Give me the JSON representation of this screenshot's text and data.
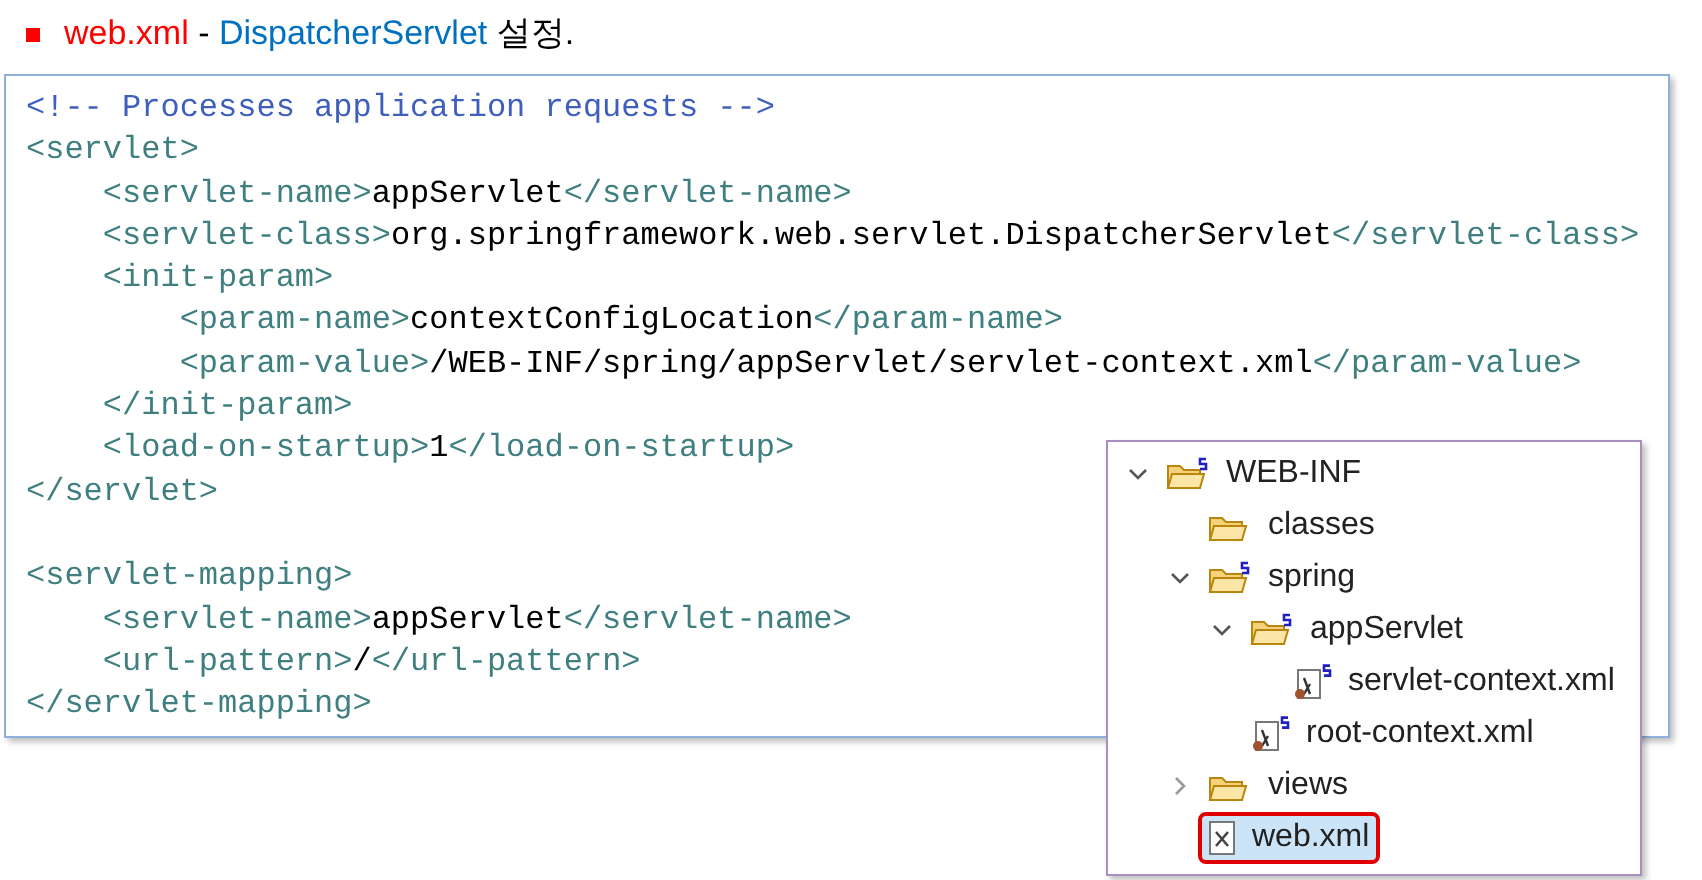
{
  "heading": {
    "parts": [
      {
        "kind": "file",
        "text": "web.xml"
      },
      {
        "kind": "plain",
        "text": " - "
      },
      {
        "kind": "class",
        "text": "DispatcherServlet"
      },
      {
        "kind": "plain",
        "text": " 설정."
      }
    ]
  },
  "code": {
    "lines": [
      {
        "tokens": [
          {
            "kind": "comment",
            "text": "<!-- Processes application requests -->"
          }
        ]
      },
      {
        "tokens": [
          {
            "kind": "tag",
            "text": "<servlet>"
          }
        ]
      },
      {
        "tokens": [
          {
            "kind": "tag",
            "text": "    <servlet-name>"
          },
          {
            "kind": "text",
            "text": "appServlet"
          },
          {
            "kind": "tag",
            "text": "</servlet-name>"
          }
        ]
      },
      {
        "tokens": [
          {
            "kind": "tag",
            "text": "    <servlet-class>"
          },
          {
            "kind": "text",
            "text": "org.springframework.web.servlet.DispatcherServlet"
          },
          {
            "kind": "tag",
            "text": "</servlet-class>"
          }
        ]
      },
      {
        "tokens": [
          {
            "kind": "tag",
            "text": "    <init-param>"
          }
        ]
      },
      {
        "tokens": [
          {
            "kind": "tag",
            "text": "        <param-name>"
          },
          {
            "kind": "text",
            "text": "contextConfigLocation"
          },
          {
            "kind": "tag",
            "text": "</param-name>"
          }
        ]
      },
      {
        "tokens": [
          {
            "kind": "tag",
            "text": "        <param-value>"
          },
          {
            "kind": "text",
            "text": "/WEB-INF/spring/appServlet/servlet-context.xml"
          },
          {
            "kind": "tag",
            "text": "</param-value>"
          }
        ]
      },
      {
        "tokens": [
          {
            "kind": "tag",
            "text": "    </init-param>"
          }
        ]
      },
      {
        "tokens": [
          {
            "kind": "tag",
            "text": "    <load-on-startup>"
          },
          {
            "kind": "text",
            "text": "1"
          },
          {
            "kind": "tag",
            "text": "</load-on-startup>"
          }
        ]
      },
      {
        "tokens": [
          {
            "kind": "tag",
            "text": "</servlet>"
          }
        ]
      },
      {
        "kind": "blank"
      },
      {
        "tokens": [
          {
            "kind": "tag",
            "text": "<servlet-mapping>"
          }
        ]
      },
      {
        "tokens": [
          {
            "kind": "tag",
            "text": "    <servlet-name>"
          },
          {
            "kind": "text",
            "text": "appServlet"
          },
          {
            "kind": "tag",
            "text": "</servlet-name>"
          }
        ]
      },
      {
        "tokens": [
          {
            "kind": "tag",
            "text": "    <url-pattern>"
          },
          {
            "kind": "text",
            "text": "/"
          },
          {
            "kind": "tag",
            "text": "</url-pattern>"
          }
        ]
      },
      {
        "tokens": [
          {
            "kind": "tag",
            "text": "</servlet-mapping>"
          }
        ]
      }
    ]
  },
  "tree": {
    "items": [
      {
        "label": "WEB-INF",
        "kind": "spring-folder",
        "expanded": true,
        "selected": false,
        "children": [
          {
            "label": "classes",
            "kind": "folder",
            "selected": false
          },
          {
            "label": "spring",
            "kind": "spring-folder",
            "expanded": true,
            "selected": false,
            "children": [
              {
                "label": "appServlet",
                "kind": "spring-folder",
                "expanded": true,
                "selected": false,
                "children": [
                  {
                    "label": "servlet-context.xml",
                    "kind": "spring-file",
                    "selected": false
                  }
                ]
              },
              {
                "label": "root-context.xml",
                "kind": "spring-file",
                "selected": false
              }
            ]
          },
          {
            "label": "views",
            "kind": "folder",
            "expanded": false,
            "selected": false
          },
          {
            "label": "web.xml",
            "kind": "xml-file",
            "selected": true
          }
        ]
      }
    ]
  }
}
